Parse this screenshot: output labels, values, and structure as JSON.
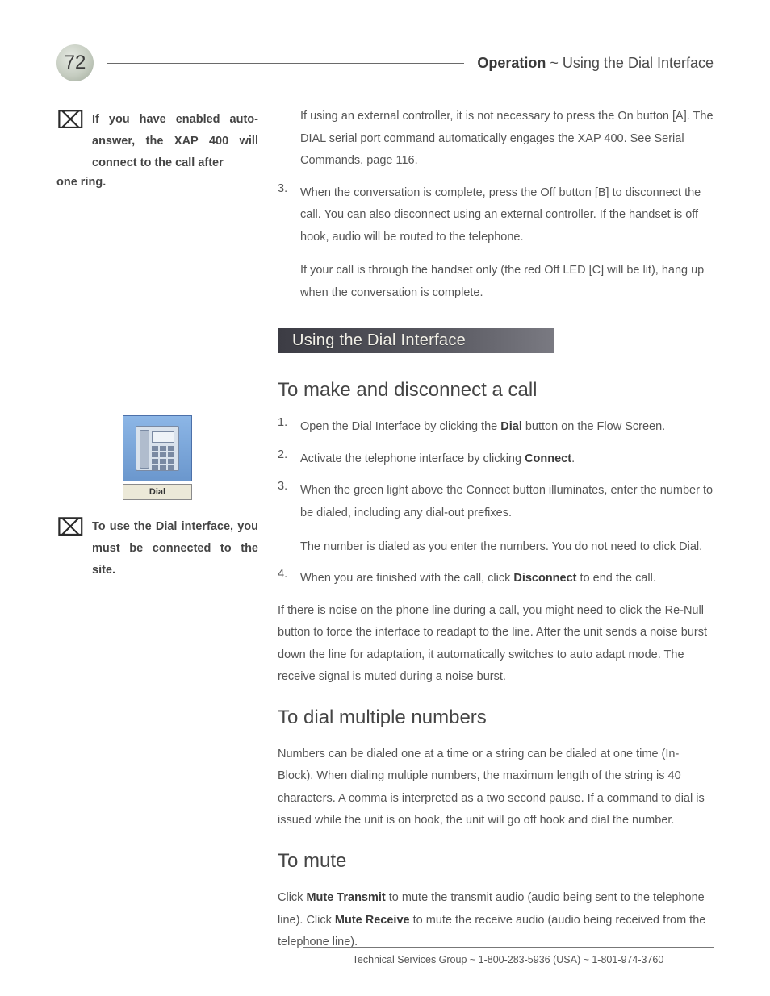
{
  "page_number": "72",
  "header_title_bold": "Operation",
  "header_title_rest": " ~ Using the Dial Interface",
  "intro_note_line1": "If you have enabled auto-answer, the XAP 400 will connect to the call after",
  "intro_note_line2": "one ring.",
  "main_intro_p1": "If using an external controller, it is not necessary to press the On button [A]. The DIAL serial port command automatically engages the XAP 400. See Serial Commands, page 116.",
  "step3_num": "3.",
  "step3_text": "When the conversation is complete, press the Off button [B] to disconnect the call. You can also disconnect using an external controller. If the handset is off hook, audio will be routed to the telephone.",
  "step3_sub": "If your call is through the handset only (the red Off LED [C] will be lit), hang up when the conversation is complete.",
  "section_bar": "Using the Dial Interface",
  "h2_make": "To make and disconnect a call",
  "dial_button_label": "Dial",
  "make_steps": [
    {
      "num": "1.",
      "pre": "Open the Dial Interface by clicking the ",
      "bold": "Dial",
      "post": " button on the Flow Screen."
    },
    {
      "num": "2.",
      "pre": " Activate the telephone interface by clicking ",
      "bold": "Connect",
      "post": "."
    },
    {
      "num": "3.",
      "pre": "When the green light above the Connect button illuminates, enter the number to be dialed, including any dial-out prefixes.",
      "bold": "",
      "post": ""
    }
  ],
  "make_sub": "The number is dialed as you enter the numbers. You do not need to click Dial.",
  "make_step4_num": "4.",
  "make_step4_pre": "When you are finished with the call, click ",
  "make_step4_bold": "Disconnect",
  "make_step4_post": " to end the call.",
  "make_after": "If there is noise on the phone line during a call, you might need to click the Re-Null button to force the interface to readapt to the line. After the unit sends a noise burst down the line for adaptation, it automatically switches to auto adapt mode. The receive signal is muted during a noise burst.",
  "side_note2": "To use the Dial interface, you must be connected to the site.",
  "h2_multiple": "To dial multiple numbers",
  "multiple_body": "Numbers can be dialed one at a time or a string can be dialed at one time (In-Block). When dialing multiple numbers, the maximum length of the string is 40 characters. A comma is interpreted as a two second pause. If a command to dial is issued while the unit is on hook, the unit will go off hook and dial the number.",
  "h2_mute": "To mute",
  "mute_pre": "Click ",
  "mute_b1": "Mute Transmit",
  "mute_mid": " to mute the transmit audio (audio being sent to the telephone line). Click ",
  "mute_b2": "Mute Receive",
  "mute_post": " to mute the receive audio (audio being received from the telephone line).",
  "footer": "Technical Services Group ~ 1-800-283-5936 (USA) ~ 1-801-974-3760"
}
